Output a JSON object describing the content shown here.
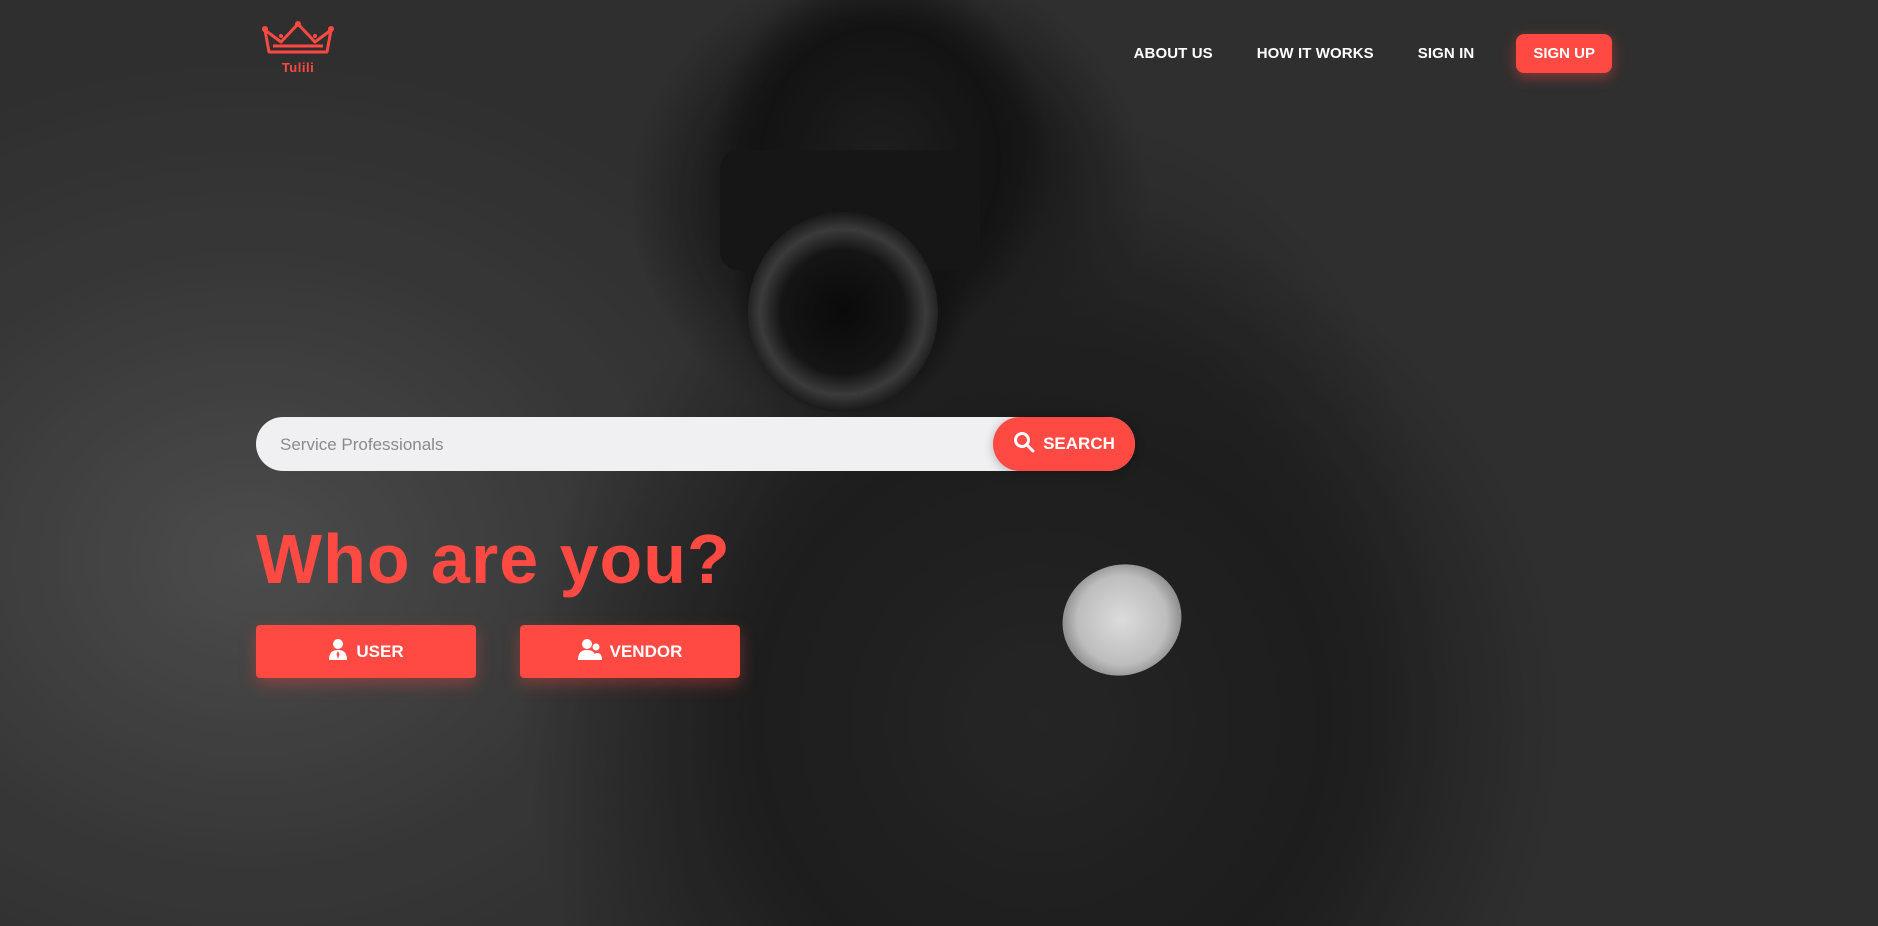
{
  "brand": {
    "logo_text": "Tulili",
    "accent_color": "#ff4a43"
  },
  "nav": {
    "items": [
      {
        "label": "ABOUT US"
      },
      {
        "label": "HOW IT WORKS"
      },
      {
        "label": "SIGN IN"
      }
    ],
    "signup_label": "SIGN UP"
  },
  "search": {
    "placeholder": "Service Professionals",
    "value": "",
    "button_label": "SEARCH",
    "button_icon": "search-icon"
  },
  "hero": {
    "heading": "Who are you?",
    "buttons": [
      {
        "label": "USER",
        "icon": "user-icon"
      },
      {
        "label": "VENDOR",
        "icon": "users-icon"
      }
    ]
  }
}
